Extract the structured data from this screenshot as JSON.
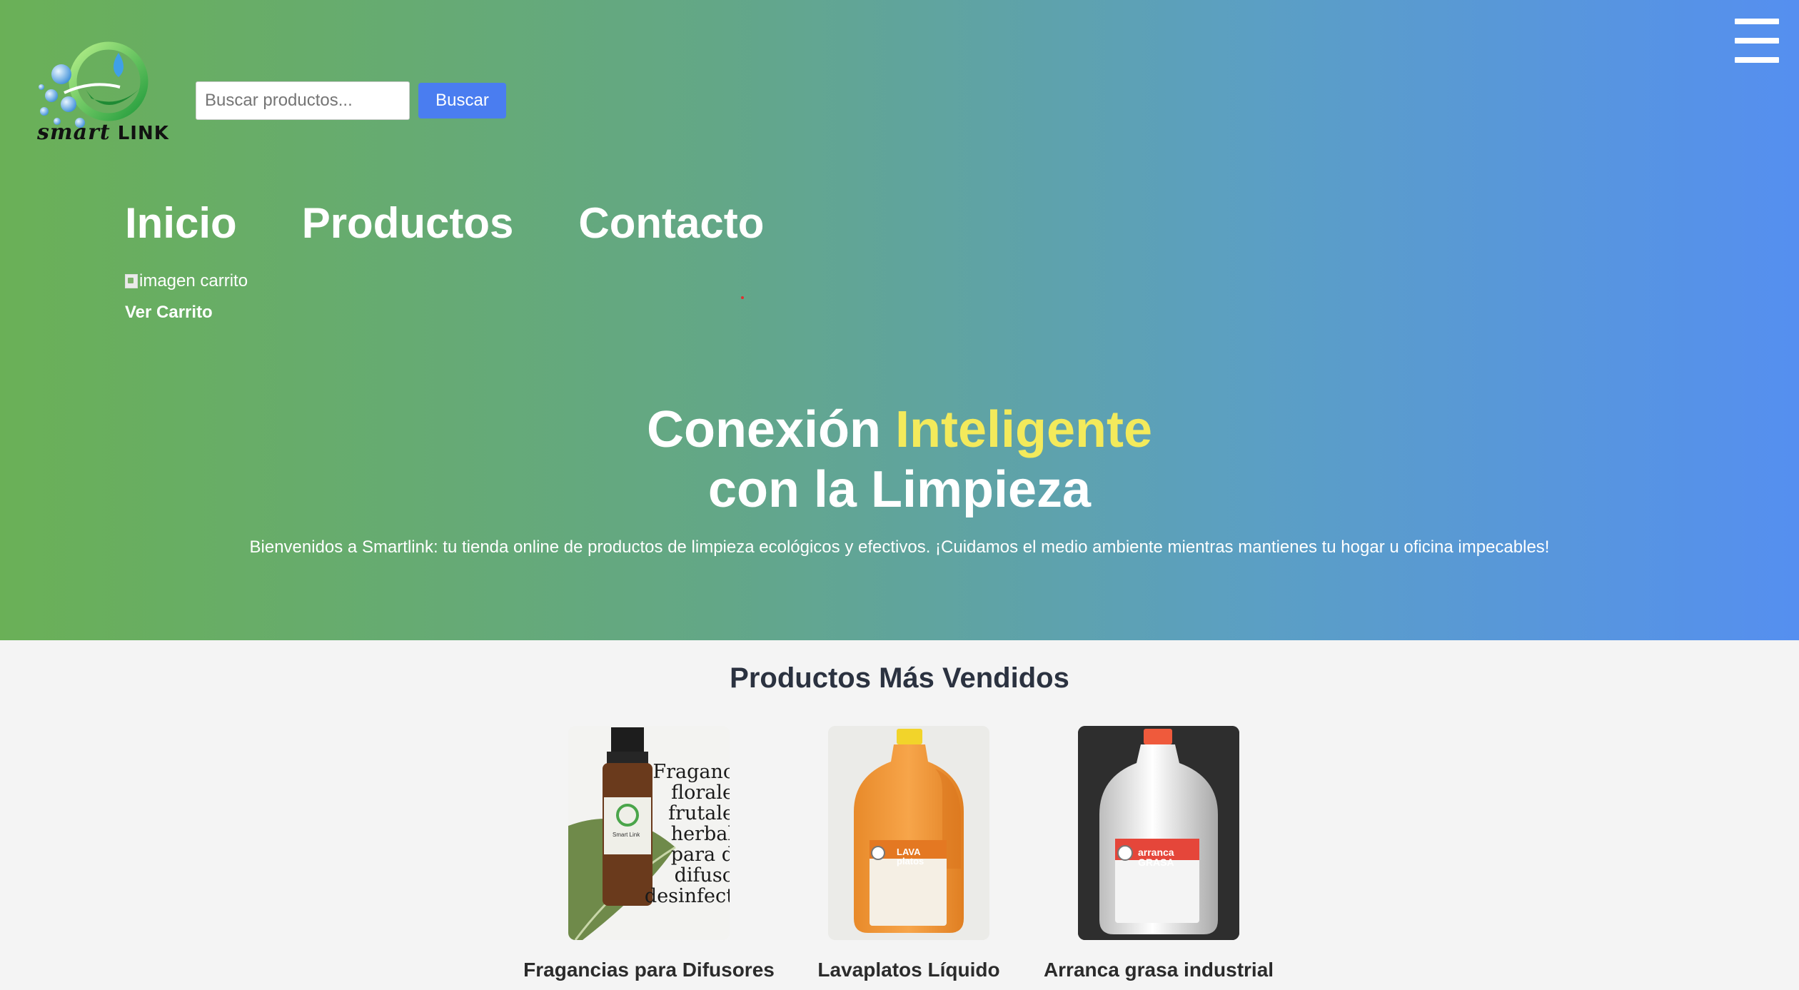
{
  "header": {
    "logo": {
      "word_smart": "smart",
      "word_link": "LINK"
    },
    "search": {
      "placeholder": "Buscar productos...",
      "button_label": "Buscar"
    },
    "menu_icon": "hamburger-icon"
  },
  "nav": {
    "items": [
      {
        "label": "Inicio"
      },
      {
        "label": "Productos"
      },
      {
        "label": "Contacto"
      }
    ],
    "cart_image_alt": "imagen carrito",
    "cart_link": "Ver Carrito"
  },
  "hero": {
    "title_part1": "Conexión ",
    "title_accent": "Inteligente",
    "title_line2": "con la Limpieza",
    "subtitle": "Bienvenidos a Smartlink: tu tienda online de productos de limpieza ecológicos y efectivos. ¡Cuidamos el medio ambiente mientras mantienes tu hogar u oficina impecables!"
  },
  "best_sellers": {
    "title": "Productos Más Vendidos",
    "products": [
      {
        "name": "Fragancias para Difusores",
        "image_text": [
          "Fraganc",
          "florale",
          "frutale",
          "herbal",
          "para d",
          "difuso",
          "desinfect"
        ],
        "label_brand": "Smart Link"
      },
      {
        "name": "Lavaplatos Líquido",
        "label_title": "LAVA platos"
      },
      {
        "name": "Arranca grasa industrial",
        "label_title": "arranca GRASA"
      }
    ]
  },
  "colors": {
    "gradient_start": "#6ab057",
    "gradient_end": "#558ff0",
    "accent_yellow": "#f3ea5b",
    "button_blue": "#4a7df0",
    "section_title": "#2b3240"
  }
}
